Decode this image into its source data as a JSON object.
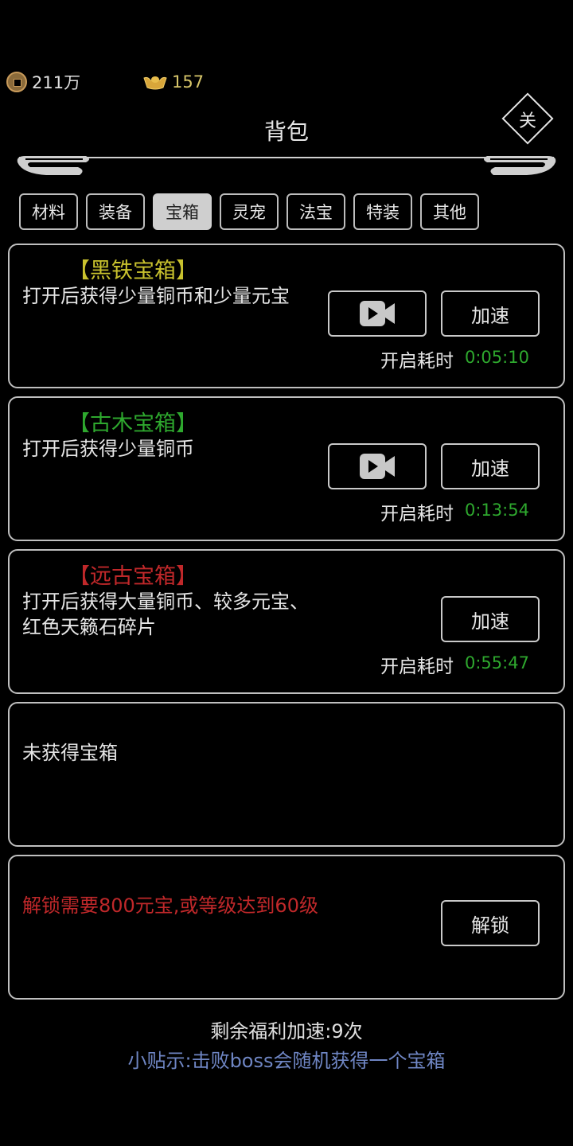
{
  "currency": {
    "coins": "211万",
    "yuanbao": "157",
    "coin_icon": "copper-coin-icon",
    "yuanbao_icon": "gold-ingot-icon"
  },
  "header": {
    "title": "背包",
    "close_label": "关"
  },
  "tabs": [
    {
      "label": "材料",
      "active": false
    },
    {
      "label": "装备",
      "active": false
    },
    {
      "label": "宝箱",
      "active": true
    },
    {
      "label": "灵宠",
      "active": false
    },
    {
      "label": "法宝",
      "active": false
    },
    {
      "label": "特装",
      "active": false
    },
    {
      "label": "其他",
      "active": false
    }
  ],
  "chests": [
    {
      "name": "【黑铁宝箱】",
      "name_color": "#c9c22e",
      "desc": "打开后获得少量铜币和少量元宝",
      "has_video": true,
      "video_icon": "video-camera-icon",
      "speed_label": "加速",
      "timer_label": "开启耗时",
      "timer": "0:05:10"
    },
    {
      "name": "【古木宝箱】",
      "name_color": "#2ea82e",
      "desc": "打开后获得少量铜币",
      "has_video": true,
      "video_icon": "video-camera-icon",
      "speed_label": "加速",
      "timer_label": "开启耗时",
      "timer": "0:13:54"
    },
    {
      "name": "【远古宝箱】",
      "name_color": "#c0282a",
      "desc_line1": "打开后获得大量铜币、较多元宝、",
      "desc_line2": "红色天籁石碎片",
      "has_video": false,
      "speed_label": "加速",
      "timer_label": "开启耗时",
      "timer": "0:55:47"
    }
  ],
  "empty_slot": {
    "text": "未获得宝箱"
  },
  "locked_slot": {
    "text": "解锁需要800元宝,或等级达到60级",
    "text_color": "#c0282a",
    "button_label": "解锁"
  },
  "footer": {
    "remaining": "剩余福利加速:9次",
    "tip": "小贴示:击败boss会随机获得一个宝箱"
  }
}
